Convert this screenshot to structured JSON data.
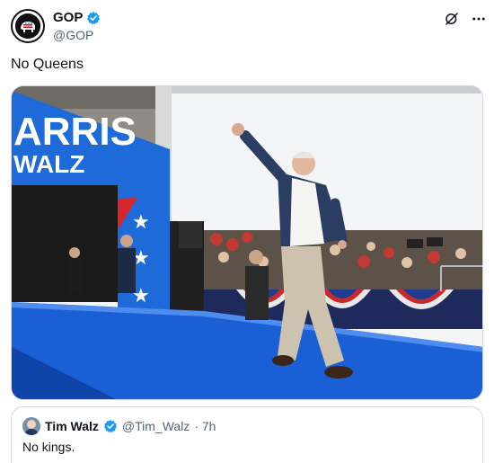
{
  "post": {
    "author_name": "GOP",
    "author_handle": "@GOP",
    "text": "No Queens",
    "media": {
      "banner_line1": "ARRIS",
      "banner_line2": "WALZ"
    }
  },
  "quoted_post": {
    "author_name": "Tim Walz",
    "author_handle": "@Tim_Walz",
    "time": "· 7h",
    "text": "No kings."
  },
  "colors": {
    "verified_blue": "#1d9bf0",
    "stage_blue": "#1a5fd6",
    "banner_blue": "#1d6ad8"
  },
  "icons": {
    "verified": "verified-badge-icon",
    "grok": "grok-icon",
    "more": "more-options-icon"
  }
}
